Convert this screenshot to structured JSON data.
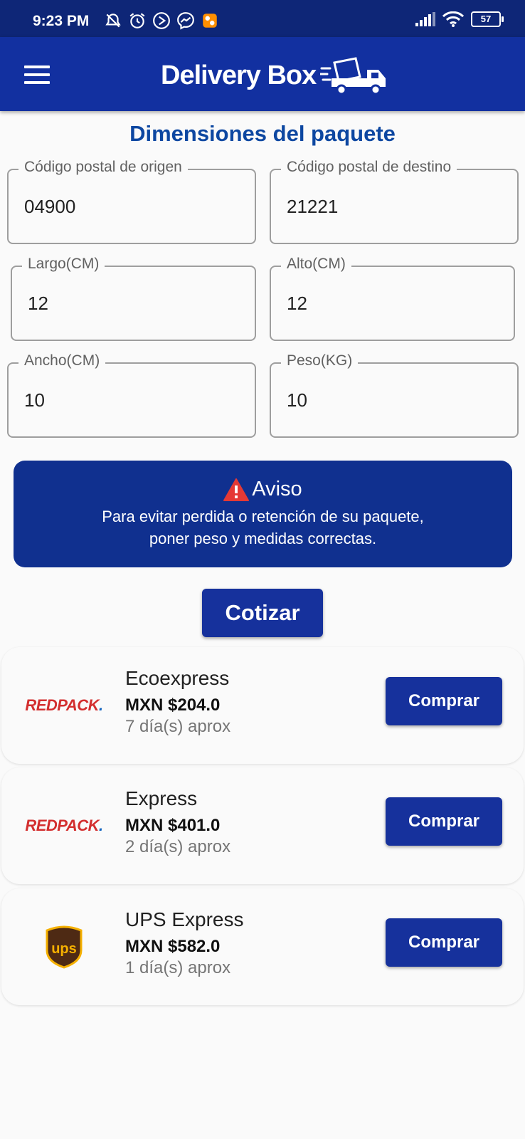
{
  "status": {
    "time": "9:23 PM",
    "battery": "57",
    "icons": [
      "muted-alarm-icon",
      "alarm-icon",
      "navigation-icon",
      "messenger-icon",
      "video-app-icon",
      "signal-icon",
      "wifi-icon",
      "battery-icon"
    ]
  },
  "appbar": {
    "brand": "Delivery Box",
    "menu_icon": "menu-icon",
    "logo_icon": "delivery-truck-icon"
  },
  "page": {
    "title": "Dimensiones del paquete"
  },
  "form": {
    "origin": {
      "label": "Código postal de origen",
      "value": "04900"
    },
    "destination": {
      "label": "Código postal de destino",
      "value": "21221"
    },
    "length": {
      "label": "Largo(CM)",
      "value": "12"
    },
    "height": {
      "label": "Alto(CM)",
      "value": "12"
    },
    "width": {
      "label": "Ancho(CM)",
      "value": "10"
    },
    "weight": {
      "label": "Peso(KG)",
      "value": "10"
    }
  },
  "notice": {
    "icon": "warning-icon",
    "title": "Aviso",
    "line1": "Para evitar perdida o retención de su paquete,",
    "line2": "poner peso y medidas correctas."
  },
  "quote_button": "Cotizar",
  "colors": {
    "primary": "#1230a0",
    "status_bar": "#0e2677",
    "title": "#0d47a1",
    "warning": "#e53935"
  },
  "results": [
    {
      "carrier": "REDPACK",
      "carrier_dot": ".",
      "service": "Ecoexpress",
      "price": "MXN $204.0",
      "days": "7 día(s) aprox",
      "button": "Comprar"
    },
    {
      "carrier": "REDPACK",
      "carrier_dot": ".",
      "service": "Express",
      "price": "MXN $401.0",
      "days": "2 día(s) aprox",
      "button": "Comprar"
    },
    {
      "carrier": "ups",
      "service": "UPS Express",
      "price": "MXN $582.0",
      "days": "1 día(s) aprox",
      "button": "Comprar"
    }
  ]
}
